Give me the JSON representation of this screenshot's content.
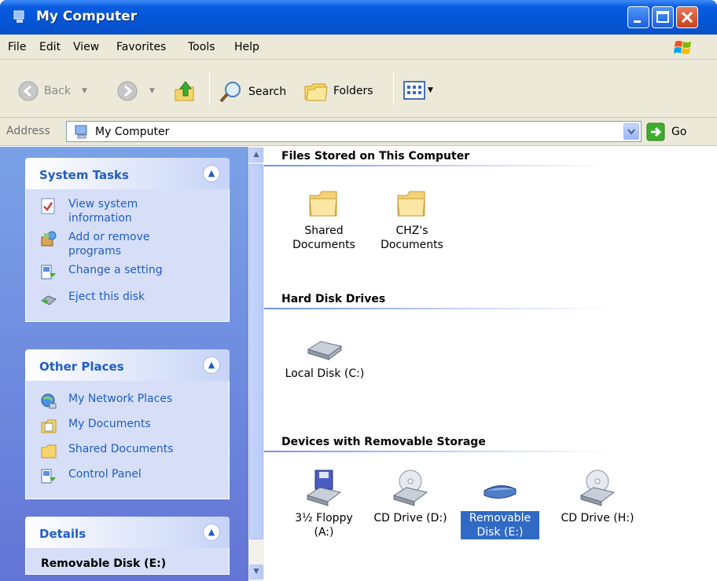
{
  "window": {
    "title": "My Computer"
  },
  "menu": [
    "File",
    "Edit",
    "View",
    "Favorites",
    "Tools",
    "Help"
  ],
  "toolbar": {
    "back": "Back",
    "search": "Search",
    "folders": "Folders"
  },
  "address": {
    "label": "Address",
    "value": "My Computer",
    "go": "Go"
  },
  "taskpane": {
    "system_tasks": {
      "title": "System Tasks",
      "items": [
        "View system information",
        "Add or remove programs",
        "Change a setting",
        "Eject this disk"
      ]
    },
    "other_places": {
      "title": "Other Places",
      "items": [
        "My Network Places",
        "My Documents",
        "Shared Documents",
        "Control Panel"
      ]
    },
    "details": {
      "title": "Details",
      "name": "Removable Disk (E:)"
    }
  },
  "content": {
    "files_group": "Files Stored on This Computer",
    "files": [
      "Shared Documents",
      "CHZ's Documents"
    ],
    "hdd_group": "Hard Disk Drives",
    "hdd": [
      "Local Disk (C:)"
    ],
    "removable_group": "Devices with Removable Storage",
    "removable": [
      "3½ Floppy (A:)",
      "CD Drive (D:)",
      "Removable Disk (E:)",
      "CD Drive (H:)"
    ],
    "selected": "Removable Disk (E:)"
  },
  "colors": {
    "title_bar": "#0456d6",
    "task_link": "#215dc6",
    "selection": "#316ac5"
  }
}
